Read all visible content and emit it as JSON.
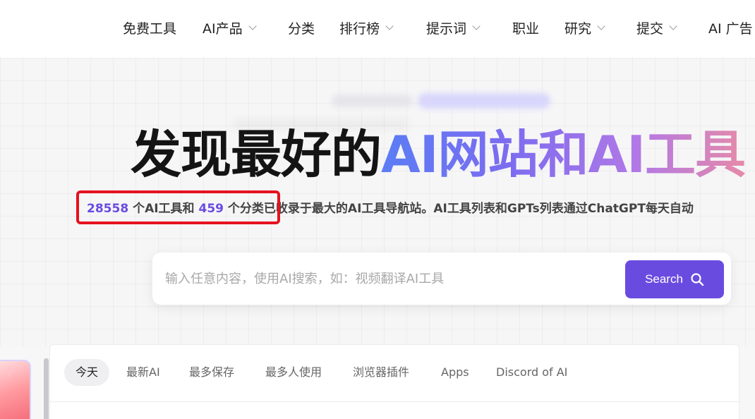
{
  "nav": {
    "items": [
      {
        "label": "免费工具",
        "dropdown": false
      },
      {
        "label": "AI产品",
        "dropdown": true
      },
      {
        "label": "分类",
        "dropdown": false
      },
      {
        "label": "排行榜",
        "dropdown": true
      },
      {
        "label": "提示词",
        "dropdown": true
      },
      {
        "label": "职业",
        "dropdown": false
      },
      {
        "label": "研究",
        "dropdown": true
      },
      {
        "label": "提交",
        "dropdown": true
      },
      {
        "label": "AI 广告",
        "dropdown": false
      }
    ]
  },
  "hero": {
    "headline_plain": "发现最好的",
    "headline_gradient": "AI网站和AI工具",
    "stats": {
      "tools_count": "28558",
      "tools_suffix": " 个AI工具和 ",
      "categories_count": "459",
      "categories_suffix": " 个分类",
      "rest": "已收录于最大的AI工具导航站。AI工具列表和GPTs列表通过ChatGPT每天自动"
    }
  },
  "search": {
    "placeholder": "输入任意内容，使用AI搜索，如：视频翻译AI工具",
    "button_label": "Search"
  },
  "tabs": {
    "items": [
      "今天",
      "最新AI",
      "最多保存",
      "最多人使用",
      "浏览器插件",
      "Apps",
      "Discord of AI"
    ],
    "active_index": 0
  },
  "colors": {
    "accent": "#6a4be0",
    "highlight_box": "#e5121f"
  }
}
